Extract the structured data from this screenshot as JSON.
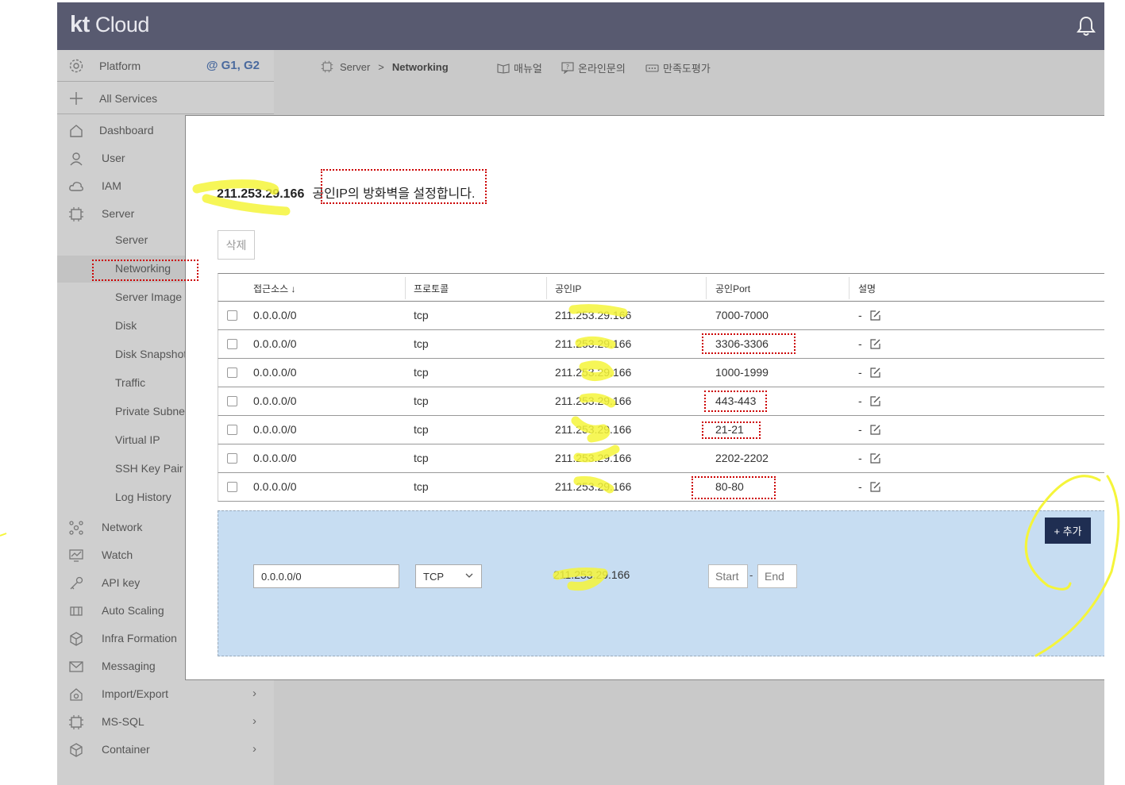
{
  "header": {
    "logo_kt": "kt",
    "logo_cloud": "Cloud"
  },
  "sidebar": {
    "platform": {
      "label": "Platform",
      "extra": "@ G1, G2"
    },
    "all_services": "All Services",
    "items_top": [
      "Dashboard",
      "User",
      "IAM",
      "Server"
    ],
    "server_sub": [
      "Server",
      "Networking",
      "Server Image",
      "Disk",
      "Disk Snapshot",
      "Traffic",
      "Private Subnet",
      "Virtual IP",
      "SSH Key Pair",
      "Log History"
    ],
    "items_bottom": [
      "Network",
      "Watch",
      "API key",
      "Auto Scaling",
      "Infra Formation",
      "Messaging",
      "Import/Export",
      "MS-SQL",
      "Container"
    ],
    "arrow": "›"
  },
  "breadcrumb": {
    "root": "Server",
    "sep": ">",
    "current": "Networking"
  },
  "quick_links": {
    "manual": "매뉴얼",
    "inquiry": "온라인문의",
    "survey": "만족도평가"
  },
  "modal": {
    "ip": "211.253.29.166",
    "message": "공인IP의 방화벽을 설정합니다.",
    "delete_label": "삭제",
    "columns": [
      "접근소스 ↓",
      "프로토콜",
      "공인IP",
      "공인Port",
      "설명"
    ],
    "rows": [
      {
        "source": "0.0.0.0/0",
        "protocol": "tcp",
        "ip": "211.253.29.166",
        "port": "7000-7000",
        "desc": "-"
      },
      {
        "source": "0.0.0.0/0",
        "protocol": "tcp",
        "ip": "211.253.29.166",
        "port": "3306-3306",
        "desc": "-"
      },
      {
        "source": "0.0.0.0/0",
        "protocol": "tcp",
        "ip": "211.253.29.166",
        "port": "1000-1999",
        "desc": "-"
      },
      {
        "source": "0.0.0.0/0",
        "protocol": "tcp",
        "ip": "211.253.29.166",
        "port": "443-443",
        "desc": "-"
      },
      {
        "source": "0.0.0.0/0",
        "protocol": "tcp",
        "ip": "211.253.29.166",
        "port": "21-21",
        "desc": "-"
      },
      {
        "source": "0.0.0.0/0",
        "protocol": "tcp",
        "ip": "211.253.29.166",
        "port": "2202-2202",
        "desc": "-"
      },
      {
        "source": "0.0.0.0/0",
        "protocol": "tcp",
        "ip": "211.253.29.166",
        "port": "80-80",
        "desc": "-"
      }
    ],
    "add_form": {
      "add_label": "+ 추가",
      "source_value": "0.0.0.0/0",
      "protocol_value": "TCP",
      "ip": "211.253.29.166",
      "start_placeholder": "Start",
      "end_placeholder": "End",
      "range_sep": "-"
    }
  },
  "colors": {
    "topbar": "#585a70",
    "sidebar": "#cfcfcf",
    "add_panel": "#c7ddf2",
    "add_button": "#1f2e52",
    "annotation_red": "#cc0000",
    "annotation_yellow": "#f5f53a"
  }
}
